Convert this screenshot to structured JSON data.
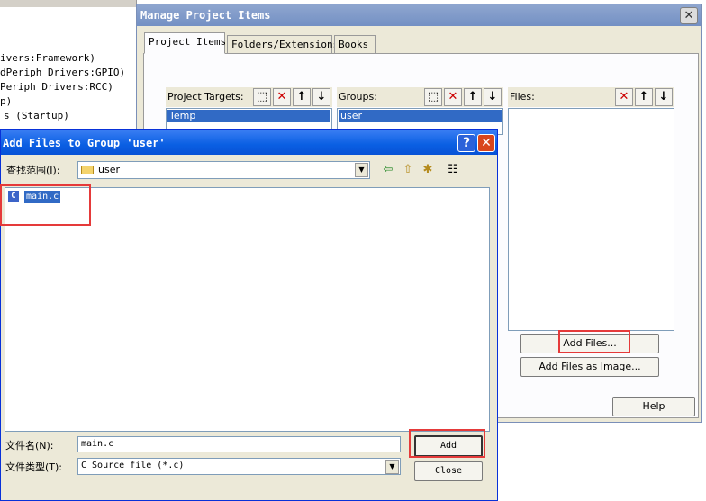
{
  "background_tree": {
    "lines": [
      "ivers:Framework)",
      "dPeriph Drivers:GPIO)",
      "Periph Drivers:RCC)",
      "p)",
      "s (Startup)"
    ]
  },
  "manage_dialog": {
    "title": "Manage Project Items",
    "close_glyph": "✕",
    "tabs": [
      "Project Items",
      "Folders/Extensions",
      "Books"
    ],
    "targets_label": "Project Targets:",
    "targets": [
      "Temp"
    ],
    "groups_label": "Groups:",
    "groups": [
      "user"
    ],
    "files_label": "Files:",
    "add_files_button": "Add Files...",
    "add_files_image_button": "Add Files as Image...",
    "help_button": "Help",
    "icon_glyphs": {
      "new": "⬚",
      "delete": "✕",
      "up": "↑",
      "down": "↓"
    }
  },
  "add_files_dialog": {
    "title": "Add Files to Group 'user'",
    "help_glyph": "?",
    "close_glyph": "✕",
    "look_in_label": "查找范围(I):",
    "look_in_value": "user",
    "toolbar_glyphs": {
      "back": "⇦",
      "up_folder": "⇧",
      "new_folder": "✱",
      "view_menu": "☷"
    },
    "files": [
      {
        "icon": "C",
        "name": "main.c"
      }
    ],
    "filename_label": "文件名(N):",
    "filename_value": "main.c",
    "filetype_label": "文件类型(T):",
    "filetype_value": "C Source file (*.c)",
    "add_button": "Add",
    "close_button": "Close"
  },
  "colors": {
    "highlight": "#e53a3a",
    "selection": "#316ac5",
    "xp_blue": "#0a5fe3"
  }
}
